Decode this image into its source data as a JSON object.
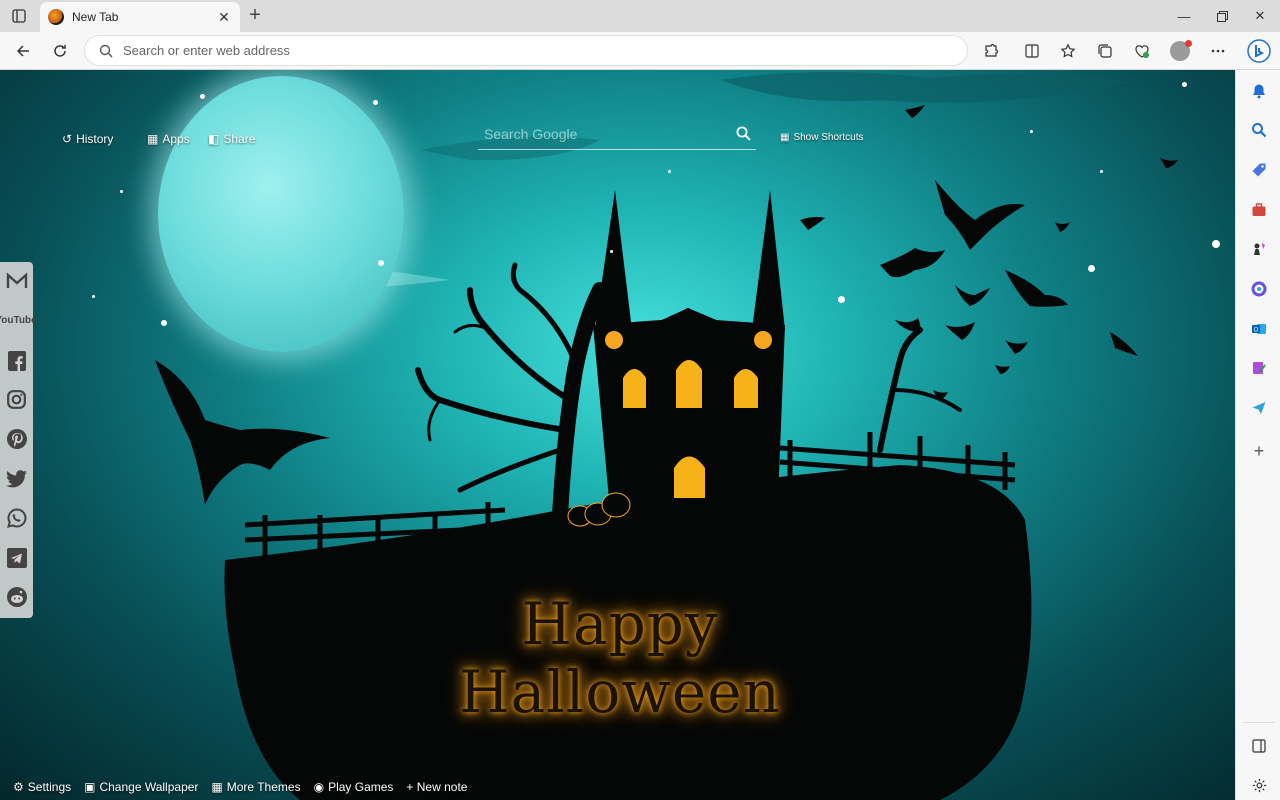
{
  "tab": {
    "title": "New Tab"
  },
  "toolbar": {
    "address_placeholder": "Search or enter web address"
  },
  "page": {
    "nav": {
      "history": "History",
      "apps": "Apps",
      "share": "Share",
      "show_shortcuts": "Show Shortcuts"
    },
    "search": {
      "placeholder": "Search Google"
    },
    "greeting": "Happy Halloween",
    "social": [
      "gmail-icon",
      "youtube-icon",
      "facebook-icon",
      "instagram-icon",
      "pinterest-icon",
      "twitter-icon",
      "whatsapp-icon",
      "telegram-icon",
      "reddit-icon"
    ],
    "youtube_label": "YouTube",
    "bottom": {
      "settings": "Settings",
      "change_wallpaper": "Change Wallpaper",
      "more_themes": "More Themes",
      "play_games": "Play Games",
      "new_note": "+ New note"
    }
  },
  "colors": {
    "accent_glow": "#f5a623",
    "window_glow": "#f7b21a",
    "sky": "#1fb3b3"
  }
}
